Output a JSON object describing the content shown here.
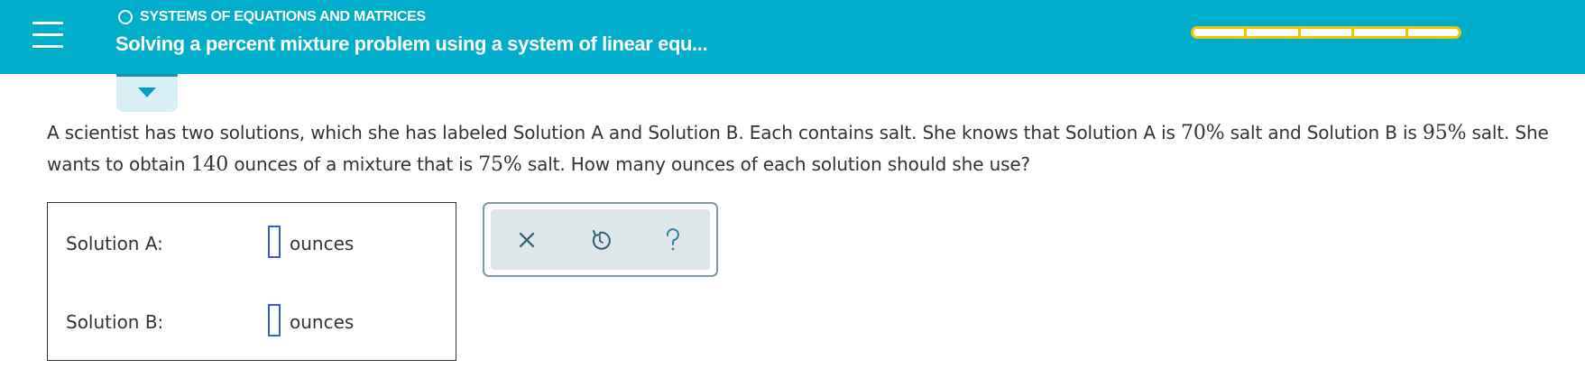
{
  "header": {
    "menu_icon": "hamburger-menu-icon",
    "topic": "SYSTEMS OF EQUATIONS AND MATRICES",
    "lesson_title": "Solving a percent mixture problem using a system of linear equ...",
    "progress_segments": 5,
    "progress_filled": 0,
    "progress_color": "#f2c300",
    "background_color": "#00adca"
  },
  "expand_tab": {
    "icon": "chevron-down-icon"
  },
  "question": {
    "part1": "A scientist has two solutions, which she has labeled Solution A and Solution B. Each contains salt. She knows that Solution A is ",
    "pct_a": "70%",
    "part2": " salt and Solution B is ",
    "pct_b": "95%",
    "part3": " salt. She wants to obtain ",
    "amount": "140",
    "part4": " ounces of a mixture that is ",
    "pct_mix": "75%",
    "part5": " salt. How many ounces of each solution should she use?"
  },
  "answers": [
    {
      "label": "Solution A:",
      "value": "",
      "unit": "ounces"
    },
    {
      "label": "Solution B:",
      "value": "",
      "unit": "ounces"
    }
  ],
  "tools": {
    "clear_icon": "close-icon",
    "undo_icon": "undo-icon",
    "help_icon": "help-icon",
    "icon_color": "#2c7fa3"
  }
}
